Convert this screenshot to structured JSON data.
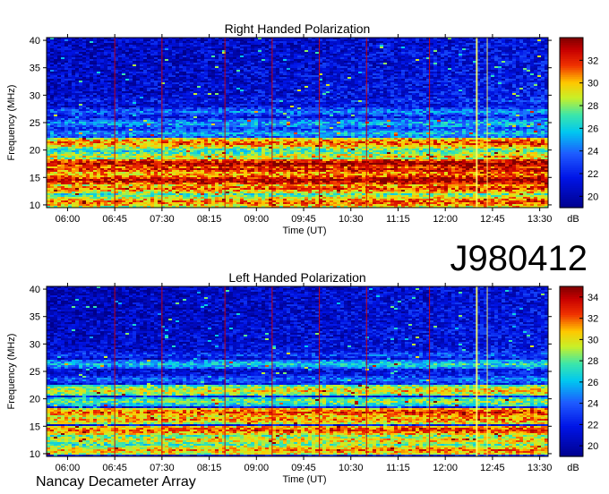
{
  "observation_id": "J980412",
  "instrument": "Nancay Decameter Array",
  "colorbar_unit": "dB",
  "x_ticks": [
    "06:00",
    "06:45",
    "07:30",
    "08:15",
    "09:00",
    "09:45",
    "10:30",
    "11:15",
    "12:00",
    "12:45",
    "13:30"
  ],
  "colors": {
    "low": "#00008c",
    "mid_low": "#1e5aff",
    "mid": "#00e6e6",
    "mid_high": "#f0f000",
    "high": "#d20000",
    "max": "#8c0000"
  },
  "chart_data": [
    {
      "type": "heatmap",
      "title": "Right Handed Polarization",
      "xlabel": "Time (UT)",
      "ylabel": "Frequency (MHz)",
      "x_ticks": [
        "06:00",
        "06:45",
        "07:30",
        "08:15",
        "09:00",
        "09:45",
        "10:30",
        "11:15",
        "12:00",
        "12:45",
        "13:30"
      ],
      "x_range": [
        "05:40",
        "13:38"
      ],
      "y_range": [
        9.5,
        40.5
      ],
      "y_ticks": [
        10,
        15,
        20,
        25,
        30,
        35,
        40
      ],
      "colorbar": {
        "label": "dB",
        "range": [
          19,
          34
        ],
        "ticks": [
          20,
          22,
          24,
          26,
          28,
          30,
          32
        ]
      },
      "bands": [
        {
          "freq": 10.5,
          "level": 31
        },
        {
          "freq": 11.5,
          "level": 28
        },
        {
          "freq": 13.0,
          "level": 31
        },
        {
          "freq": 14.5,
          "level": 33
        },
        {
          "freq": 15.5,
          "level": 30
        },
        {
          "freq": 16.5,
          "level": 32
        },
        {
          "freq": 17.5,
          "level": 33
        },
        {
          "freq": 18.8,
          "level": 29
        },
        {
          "freq": 20.0,
          "level": 27
        },
        {
          "freq": 21.3,
          "level": 31
        },
        {
          "freq": 23.0,
          "level": 25
        },
        {
          "freq": 24.8,
          "level": 25
        },
        {
          "freq": 27.0,
          "level": 24
        },
        {
          "freq": 29.0,
          "level": 22
        }
      ],
      "vertical_lines": [
        "06:45",
        "07:30",
        "08:30",
        "09:15",
        "10:00",
        "10:45",
        "11:45",
        "12:30",
        "12:40"
      ]
    },
    {
      "type": "heatmap",
      "title": "Left Handed Polarization",
      "xlabel": "Time (UT)",
      "ylabel": "Frequency (MHz)",
      "x_ticks": [
        "06:00",
        "06:45",
        "07:30",
        "08:15",
        "09:00",
        "09:45",
        "10:30",
        "11:15",
        "12:00",
        "12:45",
        "13:30"
      ],
      "x_range": [
        "05:40",
        "13:38"
      ],
      "y_range": [
        9.5,
        40.5
      ],
      "y_ticks": [
        10,
        15,
        20,
        25,
        30,
        35,
        40
      ],
      "colorbar": {
        "label": "dB",
        "range": [
          19,
          35
        ],
        "ticks": [
          20,
          22,
          24,
          26,
          28,
          30,
          32,
          34
        ]
      },
      "bands": [
        {
          "freq": 10.6,
          "level": 31
        },
        {
          "freq": 12.5,
          "level": 30
        },
        {
          "freq": 14.3,
          "level": 32
        },
        {
          "freq": 16.2,
          "level": 31
        },
        {
          "freq": 17.5,
          "level": 32
        },
        {
          "freq": 19.5,
          "level": 28
        },
        {
          "freq": 21.5,
          "level": 30
        },
        {
          "freq": 23.5,
          "level": 24
        },
        {
          "freq": 26.3,
          "level": 26
        },
        {
          "freq": 28.0,
          "level": 23
        }
      ],
      "vertical_lines": [
        "06:45",
        "07:30",
        "08:30",
        "09:15",
        "10:00",
        "10:45",
        "11:45",
        "12:30",
        "12:40"
      ]
    }
  ]
}
